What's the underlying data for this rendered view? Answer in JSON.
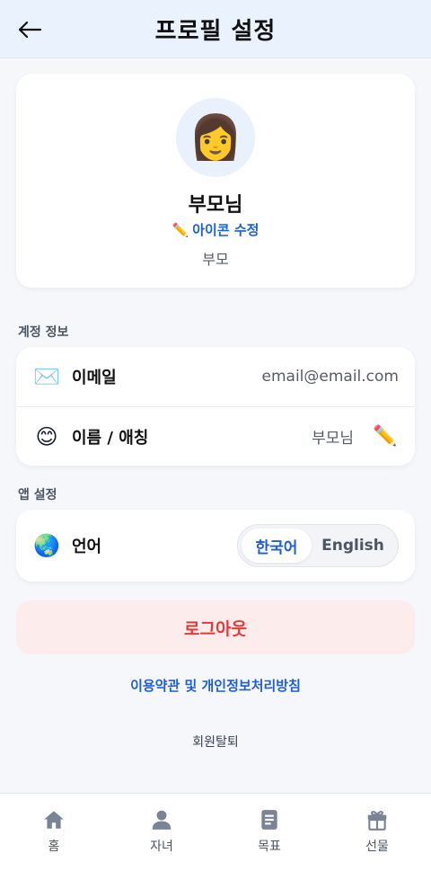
{
  "header": {
    "title": "프로필 설정",
    "back_icon": "arrow-left-icon"
  },
  "profile": {
    "avatar_emoji": "👩",
    "name": "부모님",
    "edit_icon_label": "아이콘 수정",
    "edit_icon_emoji": "✏️",
    "role": "부모"
  },
  "account_section": {
    "title": "계정 정보",
    "email": {
      "icon": "✉️",
      "label": "이메일",
      "value": "email@email.com"
    },
    "name": {
      "icon": "😊",
      "label": "이름 / 애칭",
      "value": "부모님",
      "edit_icon": "✏️"
    }
  },
  "app_section": {
    "title": "앱 설정",
    "language": {
      "icon": "🌏",
      "label": "언어",
      "options": [
        "한국어",
        "English"
      ],
      "selected": "한국어"
    }
  },
  "actions": {
    "logout_label": "로그아웃",
    "terms_label": "이용약관 및 개인정보처리방침",
    "withdraw_label": "회원탈퇴"
  },
  "bottom_nav": {
    "items": [
      {
        "label": "홈",
        "icon": "home-icon"
      },
      {
        "label": "자녀",
        "icon": "person-icon"
      },
      {
        "label": "목표",
        "icon": "document-icon"
      },
      {
        "label": "선물",
        "icon": "gift-icon"
      }
    ]
  },
  "colors": {
    "accent": "#1d5fd6",
    "danger": "#e23b3b",
    "danger_bg": "#fdecec",
    "header_bg": "#eaf2fd",
    "nav_icon": "#7b8496"
  }
}
